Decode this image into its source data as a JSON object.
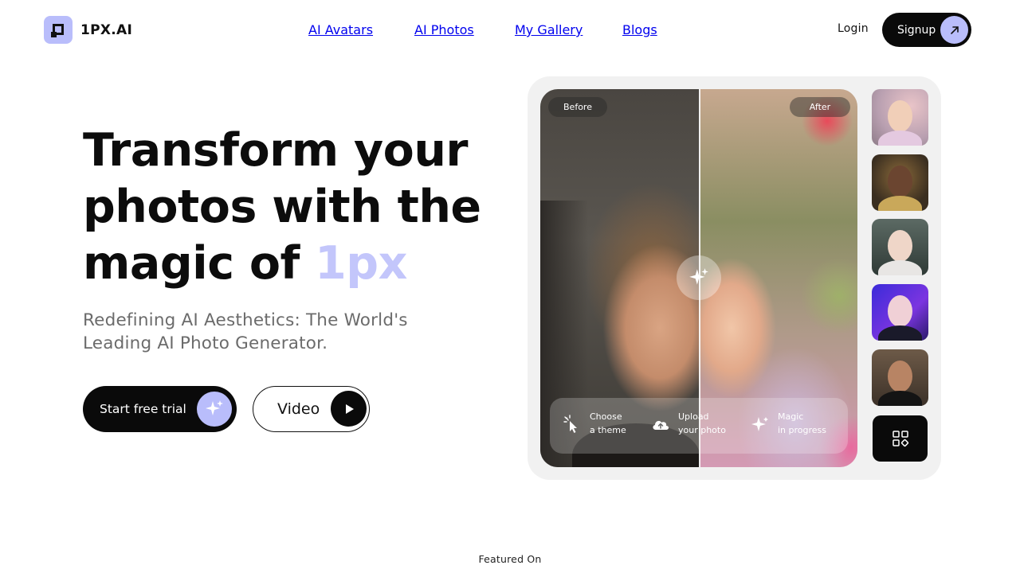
{
  "brand": {
    "name": "1PX.AI",
    "accent_color": "#b9bdfb"
  },
  "nav": {
    "items": [
      "AI Avatars",
      "AI Photos",
      "My Gallery",
      "Blogs"
    ],
    "login_label": "Login",
    "signup_label": "Signup"
  },
  "hero": {
    "title_line1": "Transform your",
    "title_line2": "photos with the",
    "title_line3_prefix": "magic of ",
    "title_line3_accent": "1px",
    "subtitle": "Redefining AI Aesthetics: The World's Leading AI Photo Generator.",
    "cta_primary": "Start free trial",
    "cta_secondary": "Video"
  },
  "showcase": {
    "before_label": "Before",
    "after_label": "After",
    "steps": [
      {
        "line1": "Choose",
        "line2": "a theme",
        "icon": "cursor-click-icon"
      },
      {
        "line1": "Upload",
        "line2": "your photo",
        "icon": "cloud-upload-icon"
      },
      {
        "line1": "Magic",
        "line2": "in progress",
        "icon": "sparkle-icon"
      }
    ],
    "thumbnail_count": 5,
    "more_icon": "grid-icon"
  },
  "footer": {
    "featured_label": "Featured On"
  }
}
